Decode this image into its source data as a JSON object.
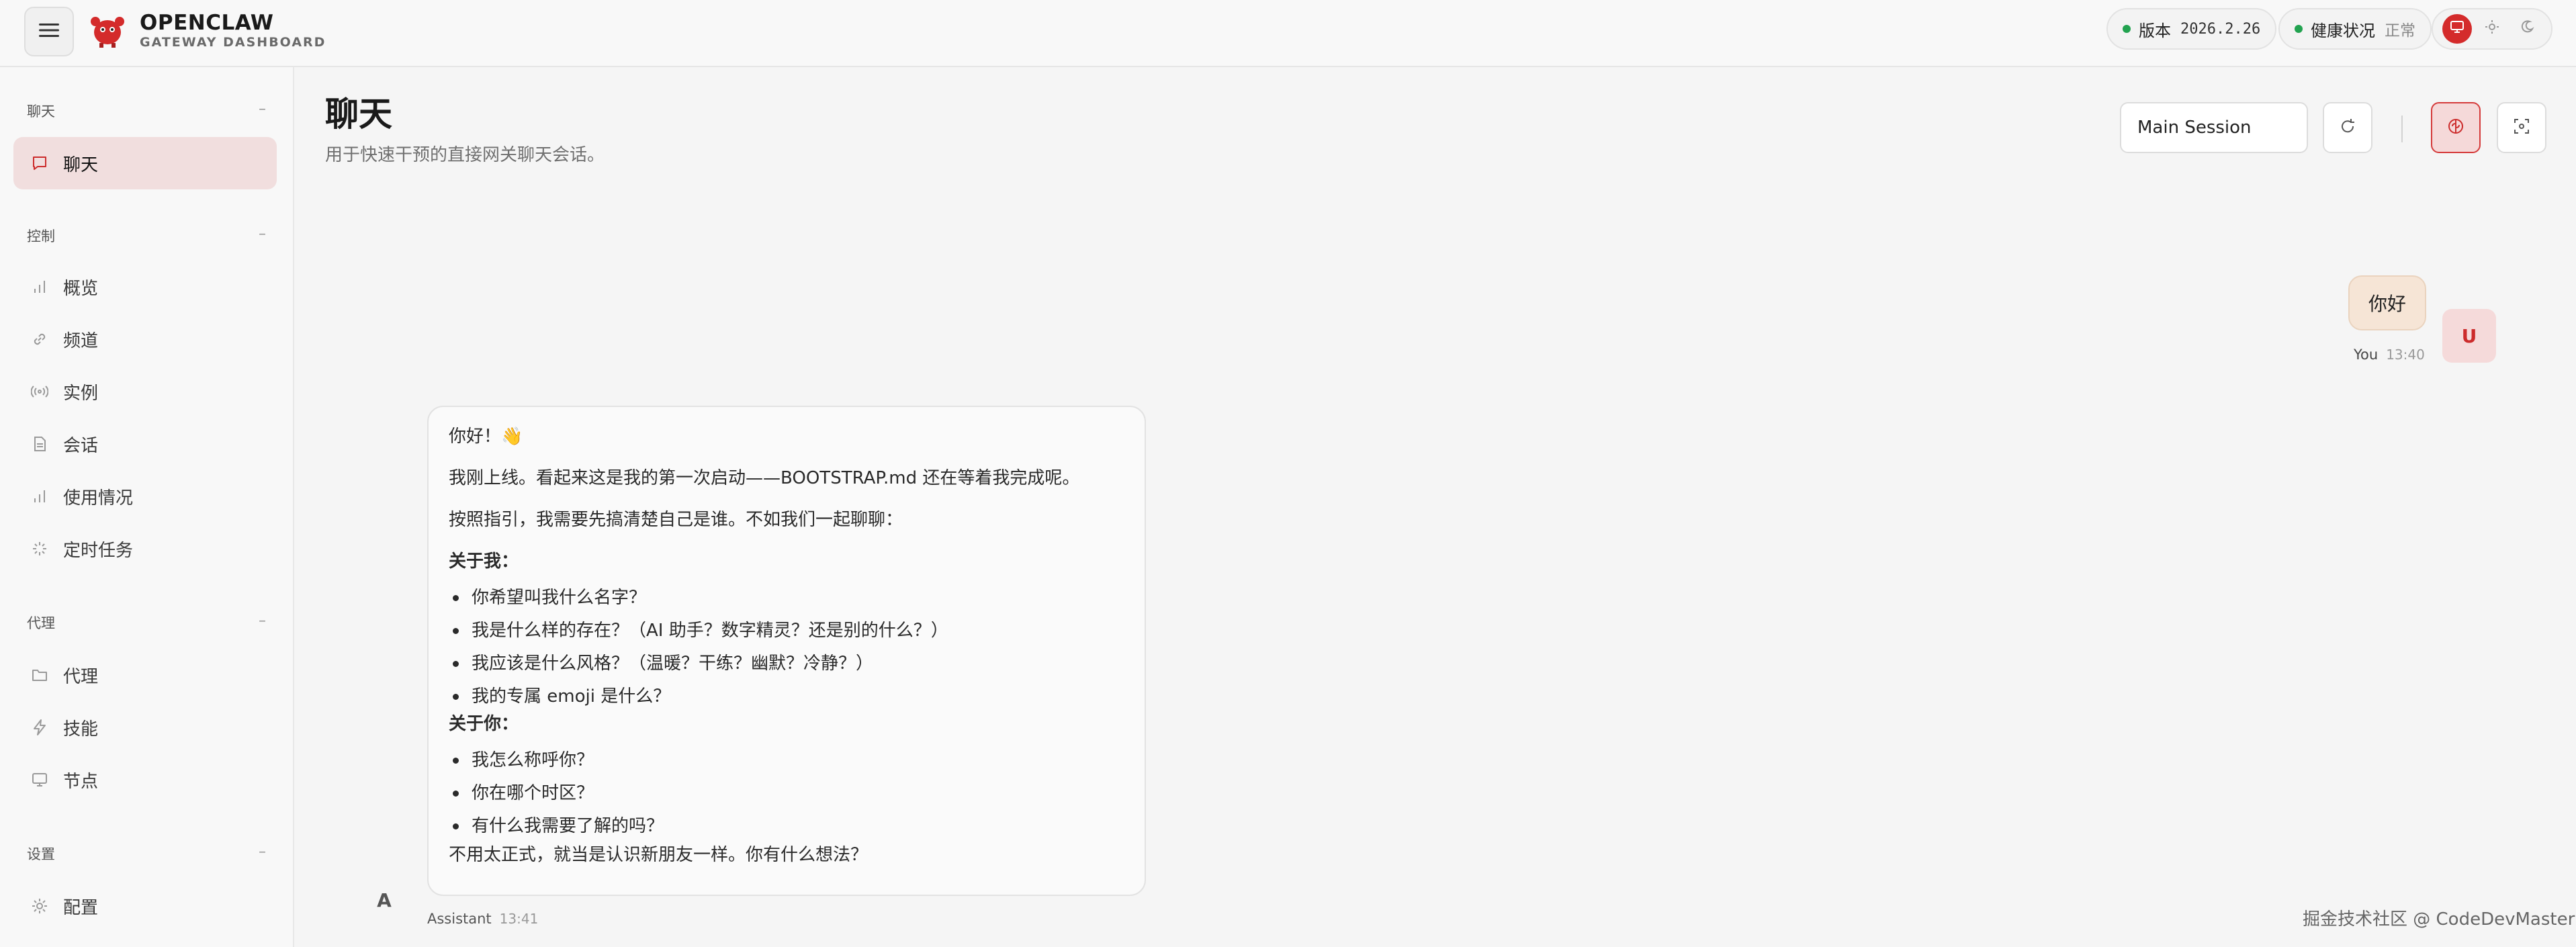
{
  "header": {
    "brand_title": "OPENCLAW",
    "brand_subtitle": "GATEWAY DASHBOARD",
    "version_label": "版本",
    "version_value": "2026.2.26",
    "health_label": "健康状况",
    "health_value": "正常",
    "status_color": "#22a350",
    "accent_color": "#d42b2b"
  },
  "sidebar": {
    "sections": [
      {
        "label": "聊天",
        "collapse": "–"
      },
      {
        "label": "控制",
        "collapse": "–"
      },
      {
        "label": "代理",
        "collapse": "–"
      },
      {
        "label": "设置",
        "collapse": "–"
      }
    ],
    "items": [
      {
        "label": "聊天",
        "icon": "chat-bubble-icon"
      },
      {
        "label": "概览",
        "icon": "bar-chart-icon"
      },
      {
        "label": "频道",
        "icon": "link-icon"
      },
      {
        "label": "实例",
        "icon": "radio-signal-icon"
      },
      {
        "label": "会话",
        "icon": "document-icon"
      },
      {
        "label": "使用情况",
        "icon": "bar-chart-icon"
      },
      {
        "label": "定时任务",
        "icon": "loader-icon"
      },
      {
        "label": "代理",
        "icon": "folder-icon"
      },
      {
        "label": "技能",
        "icon": "lightning-icon"
      },
      {
        "label": "节点",
        "icon": "monitor-icon"
      },
      {
        "label": "配置",
        "icon": "gear-icon"
      }
    ]
  },
  "main": {
    "title": "聊天",
    "subtitle": "用于快速干预的直接网关聊天会话。",
    "session_select": "Main Session"
  },
  "messages": {
    "user": {
      "text": "你好",
      "avatar": "U",
      "sender": "You",
      "time": "13:40"
    },
    "assistant": {
      "avatar": "A",
      "sender": "Assistant",
      "time": "13:41",
      "greeting": "你好！👋",
      "para1": "我刚上线。看起来这是我的第一次启动——BOOTSTRAP.md 还在等着我完成呢。",
      "para2": "按照指引，我需要先搞清楚自己是谁。不如我们一起聊聊：",
      "about_me_heading": "关于我：",
      "about_me": [
        "你希望叫我什么名字？",
        "我是什么样的存在？（AI 助手？数字精灵？还是别的什么？）",
        "我应该是什么风格？（温暖？干练？幽默？冷静？）",
        "我的专属 emoji 是什么？"
      ],
      "about_you_heading": "关于你：",
      "about_you": [
        "我怎么称呼你？",
        "你在哪个时区？",
        "有什么我需要了解的吗？"
      ],
      "closing": "不用太正式，就当是认识新朋友一样。你有什么想法？"
    }
  },
  "watermark": "掘金技术社区 @ CodeDevMaster"
}
